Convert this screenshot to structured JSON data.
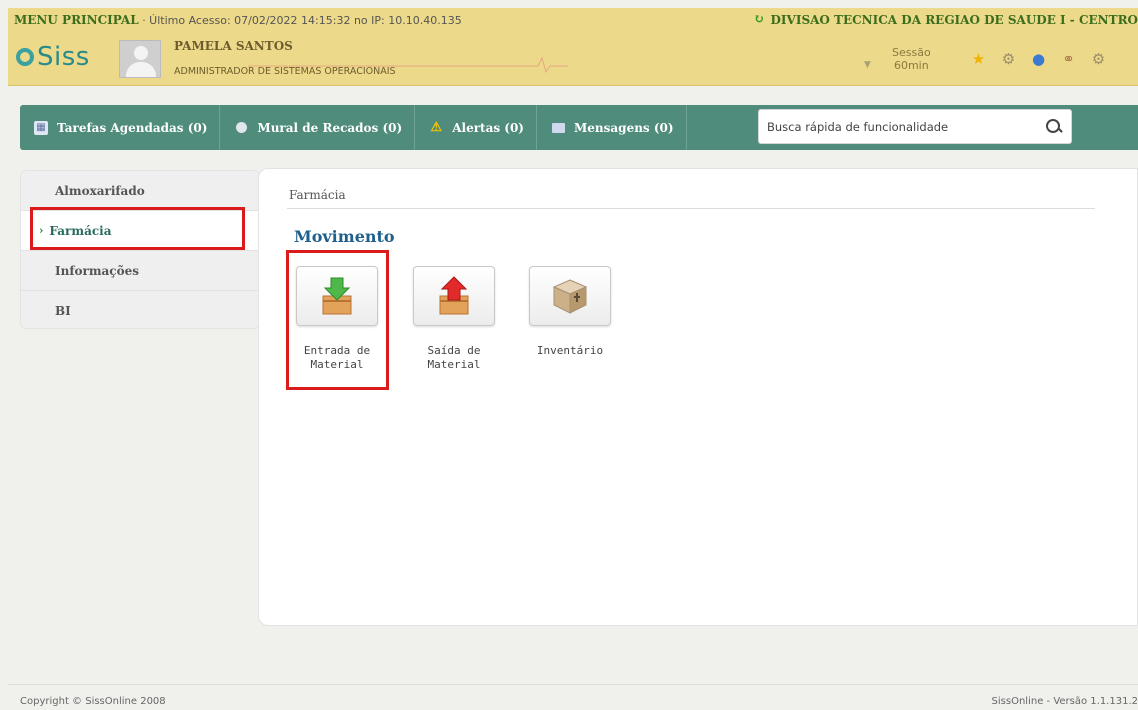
{
  "header": {
    "menu_label": "MENU PRINCIPAL",
    "last_access": "· Último Acesso: 07/02/2022 14:15:32 no IP: 10.10.40.135",
    "org": "DIVISAO TECNICA DA REGIAO DE SAUDE I - CENTRO",
    "logo": "Siss",
    "user_name": "PAMELA SANTOS",
    "user_role": "ADMINISTRADOR DE SISTEMAS OPERACIONAIS",
    "session_label": "Sessão",
    "session_time": "60min"
  },
  "toolbar": {
    "tasks": "Tarefas Agendadas (0)",
    "mural": "Mural de Recados (0)",
    "alerts": "Alertas (0)",
    "messages": "Mensagens (0)",
    "search_placeholder": "Busca rápida de funcionalidade"
  },
  "sidebar": {
    "items": [
      {
        "label": "Almoxarifado"
      },
      {
        "label": "Farmácia",
        "active": true
      },
      {
        "label": "Informações"
      },
      {
        "label": "BI"
      }
    ]
  },
  "main": {
    "breadcrumb": "Farmácia",
    "section_title": "Movimento",
    "tiles": [
      {
        "line1": "Entrada de",
        "line2": "Material"
      },
      {
        "line1": "Saída de",
        "line2": "Material"
      },
      {
        "line1": "Inventário",
        "line2": ""
      }
    ]
  },
  "footer": {
    "copyright": "Copyright © SissOnline 2008",
    "version": "SissOnline - Versão 1.1.131.2"
  },
  "colors": {
    "header_bg": "#ecd98a",
    "toolbar_bg": "#4f8c7c",
    "highlight": "#d91b1b",
    "section_title": "#1f5f8c"
  }
}
